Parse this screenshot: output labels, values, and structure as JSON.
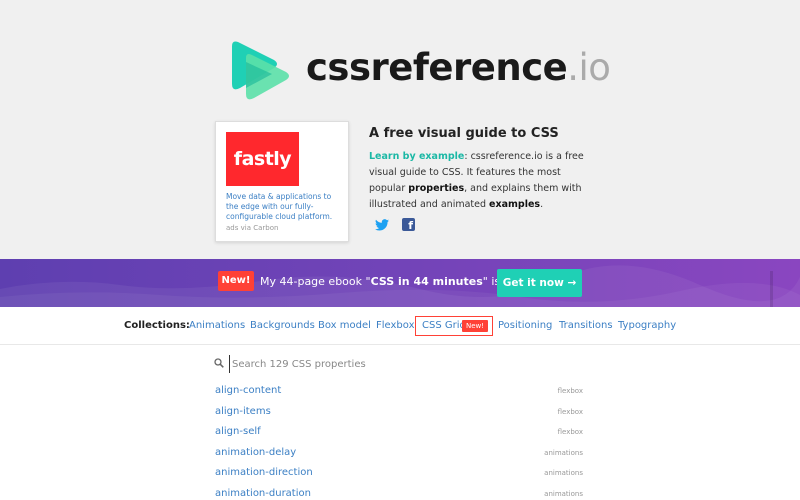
{
  "logo": {
    "name": "cssreference",
    "tld": ".io",
    "brand_colors": [
      "#1fd0b5",
      "#34c9a6"
    ]
  },
  "ad": {
    "brand": "fastly",
    "text": "Move data & applications to the edge with our fully-configurable cloud platform.",
    "via": "ads via Carbon",
    "brand_color": "#ff282d"
  },
  "about": {
    "title": "A free visual guide to CSS",
    "learn_by_example": "Learn by example",
    "text_1": ": cssreference.io is a free visual guide to CSS. It features the most popular ",
    "properties": "properties",
    "text_2": ", and explains them with illustrated and animated ",
    "examples": "examples",
    "text_3": "."
  },
  "social": {
    "icons": [
      "twitter-icon",
      "facebook-icon"
    ]
  },
  "banner": {
    "badge": "New!",
    "text_before": "My 44-page ebook \"",
    "text_bold": "CSS in 44 minutes",
    "text_after": "\" is out!",
    "cta": "Get it now →",
    "badge_color": "#ff4136",
    "cta_color": "#1fd0b5"
  },
  "collections": {
    "label": "Collections:",
    "items": [
      "Animations",
      "Backgrounds",
      "Box model",
      "Flexbox",
      "CSS Grid",
      "Positioning",
      "Transitions",
      "Typography"
    ],
    "grid_badge": "New!"
  },
  "search": {
    "placeholder": "Search 129 CSS properties",
    "value": ""
  },
  "properties": [
    {
      "name": "align-content",
      "category": "flexbox"
    },
    {
      "name": "align-items",
      "category": "flexbox"
    },
    {
      "name": "align-self",
      "category": "flexbox"
    },
    {
      "name": "animation-delay",
      "category": "animations"
    },
    {
      "name": "animation-direction",
      "category": "animations"
    },
    {
      "name": "animation-duration",
      "category": "animations"
    }
  ]
}
